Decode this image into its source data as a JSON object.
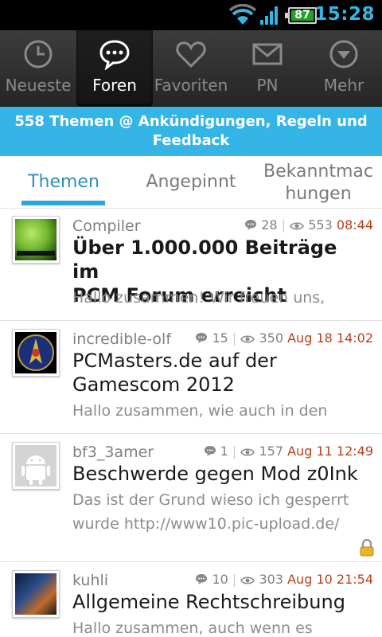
{
  "status_bar": {
    "time": "15:28",
    "battery_level": "87",
    "wifi_level": 3,
    "signal_level": 4
  },
  "colors": {
    "accent": "#34b5e6",
    "date": "#b8401e",
    "tab_indicator": "#2aa8d9"
  },
  "tabbar": {
    "items": [
      {
        "label": "Neueste",
        "icon": "clock-icon",
        "active": false
      },
      {
        "label": "Foren",
        "icon": "chat-bubble-icon",
        "active": true
      },
      {
        "label": "Favoriten",
        "icon": "heart-icon",
        "active": false
      },
      {
        "label": "PN",
        "icon": "envelope-icon",
        "active": false
      },
      {
        "label": "Mehr",
        "icon": "chevron-down-circle-icon",
        "active": false
      }
    ]
  },
  "banner": {
    "line1": "558 Themen @ Ankündigungen, Regeln und",
    "line2": "Feedback"
  },
  "subtabs": [
    {
      "label": "Themen",
      "active": true
    },
    {
      "label": "Angepinnt",
      "active": false
    },
    {
      "label_line1": "Bekanntmac",
      "label_line2": "hungen",
      "active": false
    }
  ],
  "topics": [
    {
      "author": "Compiler",
      "replies": "28",
      "views": "553",
      "date": "08:44",
      "title_line1": "Über 1.000.000 Beiträge im",
      "title_line2": "PCM Forum erreicht",
      "bold": true,
      "excerpt_line1": "Hallo zusammen! Wir freuen uns,",
      "excerpt_line2": "",
      "locked": false,
      "avatar": "compiler-logo"
    },
    {
      "author": "incredible-olf",
      "replies": "15",
      "views": "350",
      "date": "Aug 18 14:02",
      "title_line1": "PCMasters.de auf der",
      "title_line2": "Gamescom 2012",
      "bold": false,
      "excerpt_line1": "Hallo zusammen, wie auch in den",
      "excerpt_line2": "",
      "locked": false,
      "avatar": "starfleet-logo"
    },
    {
      "author": "bf3_3amer",
      "replies": "1",
      "views": "157",
      "date": "Aug 11 12:49",
      "title_line1": "Beschwerde gegen Mod z0Ink",
      "title_line2": "",
      "bold": false,
      "excerpt_line1": "Das ist der Grund wieso ich gesperrt",
      "excerpt_line2": "wurde http://www10.pic-upload.de/",
      "locked": true,
      "avatar": "android-default"
    },
    {
      "author": "kuhli",
      "replies": "10",
      "views": "303",
      "date": "Aug 10 21:54",
      "title_line1": "Allgemeine Rechtschreibung",
      "title_line2": "",
      "bold": false,
      "excerpt_line1": "Hallo zusammen, auch wenn es",
      "excerpt_line2": "",
      "locked": false,
      "avatar": "transformer-image"
    }
  ]
}
